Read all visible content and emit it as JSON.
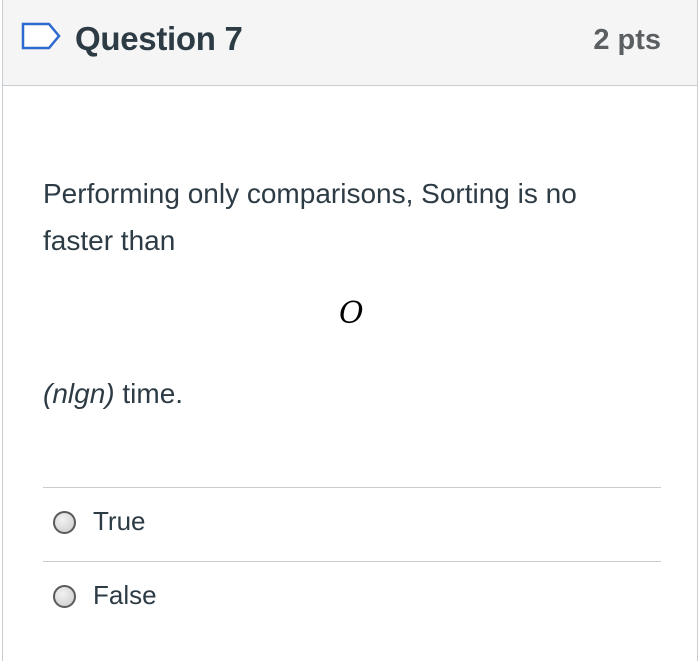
{
  "question": {
    "title": "Question 7",
    "points": "2 pts",
    "text": "Performing only comparisons, Sorting is no faster than",
    "math_symbol": "O",
    "after_italic": "(nlgn)",
    "after_text": " time."
  },
  "answers": [
    {
      "label": "True",
      "selected": false
    },
    {
      "label": "False",
      "selected": false
    }
  ],
  "icons": {
    "flag": "bookmark-flag-icon"
  },
  "colors": {
    "header_bg": "#f5f5f5",
    "text": "#2d3b45",
    "flag_outline": "#2d6acf"
  }
}
